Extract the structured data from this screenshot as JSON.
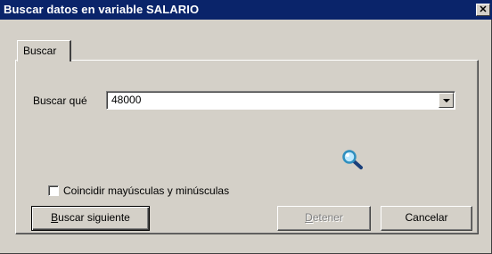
{
  "window": {
    "title": "Buscar datos en variable SALARIO",
    "close_glyph": "✕"
  },
  "tabs": [
    {
      "label": "Buscar",
      "selected": true
    }
  ],
  "search": {
    "label": "Buscar qué",
    "value": "48000"
  },
  "options": {
    "match_case_label": "Coincidir mayúsculas y minúsculas",
    "match_case_checked": false
  },
  "buttons": {
    "find_next_mnemonic": "B",
    "find_next_rest": "uscar siguiente",
    "stop_mnemonic": "D",
    "stop_rest": "etener",
    "stop_enabled": false,
    "cancel": "Cancelar"
  },
  "icons": {
    "close": "close-icon",
    "dropdown": "chevron-down-icon",
    "searching": "magnifier-icon"
  },
  "colors": {
    "titlebar": "#0a246a",
    "face": "#d4d0c8",
    "lens": "#2f8fbf"
  }
}
